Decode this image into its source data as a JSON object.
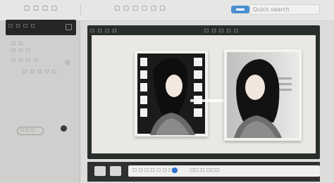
{
  "topbar": {
    "title": "☐ ☐ ☐ ☐",
    "center_title": "☐ ☐ ☐ ☐ ☐ ☐",
    "search_placeholder": "Quick search"
  },
  "left_panel": {
    "selected_label": "☐ ☐ ☐ ☐",
    "lines": [
      "☐ ☐",
      "☐ ☐ ☐",
      "☐ ☐ ☐ ☐",
      "☐ ☐ ☐ ☐ ☐"
    ],
    "pill_label": "☐ ☐ ☐"
  },
  "editor": {
    "toolbar_left": "☐ ☐ ☐ ☐",
    "toolbar_right": "☐ ☐ ☐ ☐ ☐"
  },
  "timeline": {
    "label": "☐ ☐ ☐ ☐ ☐ ☐ ☐",
    "time": "☐☐ ☐ ☐☐☐"
  },
  "colors": {
    "accent": "#4a8fd1",
    "playhead": "#2a6fd1"
  }
}
